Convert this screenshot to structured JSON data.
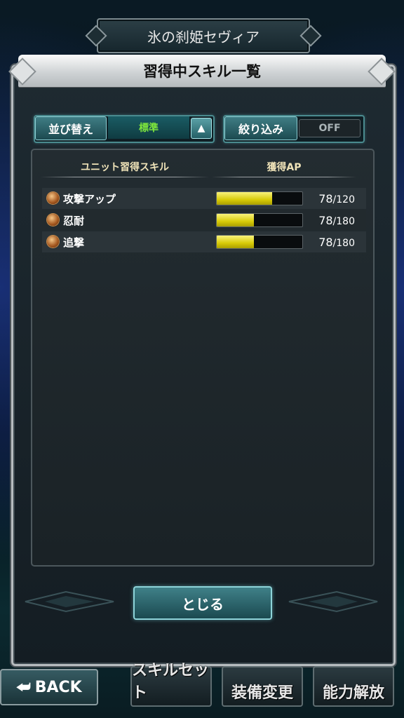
{
  "character_name": "氷の刹姫セヴィア",
  "dialog": {
    "title": "習得中スキル一覧",
    "sort_label": "並び替え",
    "sort_value": "標準",
    "filter_label": "絞り込み",
    "filter_value": "OFF",
    "columns": {
      "skill": "ユニット習得スキル",
      "ap": "獲得AP"
    },
    "rows": [
      {
        "name": "攻撃アップ",
        "current": "78",
        "max": "/120",
        "progress": 0.65
      },
      {
        "name": "忍耐",
        "current": "78",
        "max": "/180",
        "progress": 0.433
      },
      {
        "name": "追撃",
        "current": "78",
        "max": "/180",
        "progress": 0.433
      }
    ],
    "close_label": "とじる"
  },
  "bottom_bar": {
    "back_label": "BACK",
    "tabs": [
      "スキルセット",
      "装備変更",
      "能力解放"
    ]
  }
}
